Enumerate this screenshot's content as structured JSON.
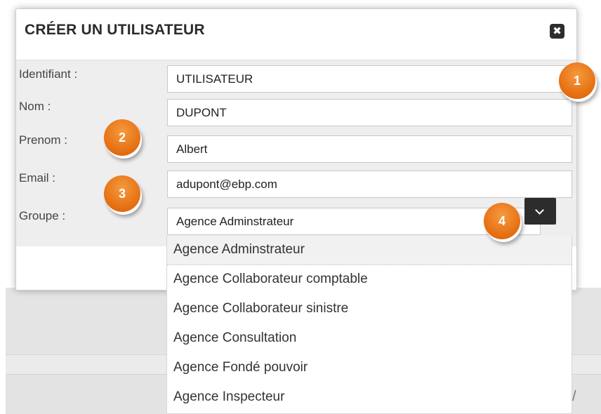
{
  "modal": {
    "title": "CRÉER UN UTILISATEUR",
    "close_icon": "close-icon"
  },
  "form": {
    "identifiant": {
      "label": "Identifiant :",
      "value": "UTILISATEUR"
    },
    "nom": {
      "label": "Nom :",
      "value": "DUPONT"
    },
    "prenom": {
      "label": "Prenom :",
      "value": "Albert"
    },
    "email": {
      "label": "Email :",
      "value": "adupont@ebp.com"
    },
    "groupe": {
      "label": "Groupe :",
      "value": "Agence Adminstrateur",
      "toggle_icon": "chevron-down-icon"
    }
  },
  "dropdown": {
    "options": [
      "Agence Adminstrateur",
      "Agence Collaborateur comptable",
      "Agence Collaborateur sinistre",
      "Agence Consultation",
      "Agence Fondé pouvoir",
      "Agence Inspecteur"
    ],
    "selected_index": 0
  },
  "markers": [
    "1",
    "2",
    "3",
    "4"
  ],
  "background": {
    "partial_text": "/"
  },
  "colors": {
    "marker_orange": "#e56d10",
    "dark_button": "#2c2c2c"
  }
}
